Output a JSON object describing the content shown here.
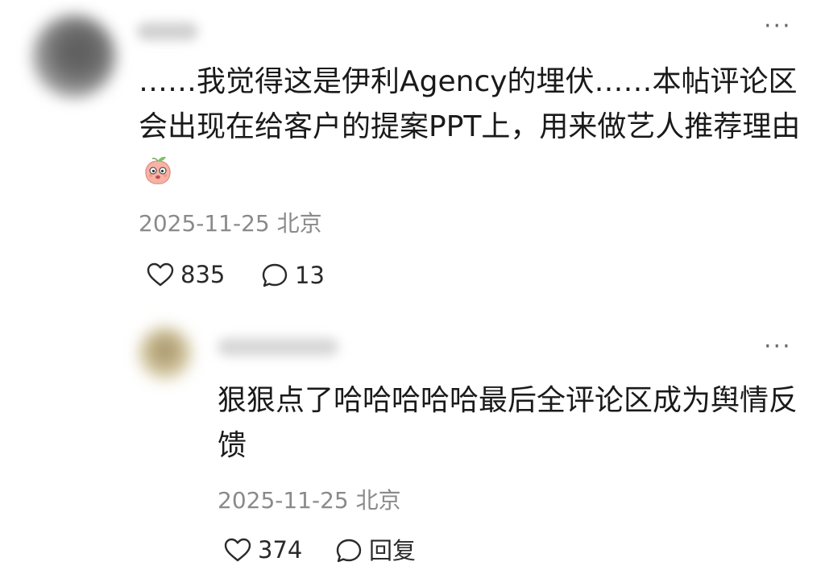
{
  "comment": {
    "text": "……我觉得这是伊利Agency的埋伏……本帖评论区会出现在给客户的提案PPT上，用来做艺人推荐理由",
    "emoji_icon": "peach-face-emoji-icon",
    "date": "2025-11-25",
    "location": "北京",
    "likes": "835",
    "replies": "13",
    "more_icon": "more-icon"
  },
  "reply": {
    "text": "狠狠点了哈哈哈哈哈最后全评论区成为舆情反馈",
    "date": "2025-11-25",
    "location": "北京",
    "likes": "374",
    "reply_label": "回复",
    "more_icon": "more-icon"
  },
  "colors": {
    "text": "#1a1a1a",
    "meta": "#8a8a8a",
    "icon": "#2a2a2a"
  }
}
